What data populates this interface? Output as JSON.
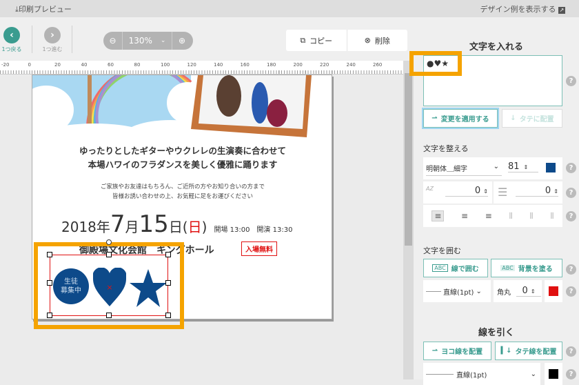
{
  "topbar": {
    "print_preview": "印刷プレビュー",
    "show_design_examples": "デザイン例を表示する"
  },
  "toolbar": {
    "undo": "1つ戻る",
    "redo": "1つ進む",
    "zoom_level": "130%",
    "copy": "コピー",
    "delete": "削除"
  },
  "ruler": {
    "ticks": [
      "-20",
      "0",
      "20",
      "40",
      "60",
      "80",
      "100",
      "120",
      "140",
      "160",
      "180",
      "200",
      "220",
      "240",
      "260"
    ]
  },
  "document": {
    "line1": "ゆったりとしたギターやウクレレの生演奏に合わせて",
    "line2": "本場ハワイのフラダンスを美しく優雅に踊ります",
    "small1": "ご家族やお友達はもちろん、ご近所の方やお知り合いの方まで",
    "small2": "皆様お誘い合わせの上、お気軽に足をお運びください",
    "date_year": "2018年",
    "date_month": "7",
    "date_month_unit": "月",
    "date_day": "15",
    "date_day_unit": "日(",
    "weekday": "日",
    "date_close": ")",
    "times": "開場 13:00　開演 13:30",
    "venue": "御殿場文化会館　キングホール",
    "free_badge": "入場無料",
    "circle_text": "生徒\n募集中"
  },
  "panel": {
    "enter_text_title": "文字を入れる",
    "text_value": "●♥★",
    "apply_button": "変更を適用する",
    "vertical_button": "タテに配置",
    "arrange_title": "文字を整える",
    "font": "明朝体＿細字",
    "font_size": "81",
    "text_color": "#0d4a8a",
    "letter_spacing": "0",
    "line_spacing": "0",
    "surround_title": "文字を囲む",
    "border_button": "線で囲む",
    "bg_button": "背景を塗る",
    "abc": "ABC",
    "border_style": "直線(1pt)",
    "corner_label": "角丸",
    "corner_value": "0",
    "border_color": "#e01010",
    "draw_line_title": "線を引く",
    "h_line_button": "ヨコ線を配置",
    "v_line_button": "タテ線を配置",
    "line_style": "直線(1pt)",
    "line_color": "#000000",
    "help": "?"
  },
  "colors": {
    "accent": "#3a9c8f",
    "highlight": "#f5a300",
    "shape_blue": "#0d4a8a"
  }
}
